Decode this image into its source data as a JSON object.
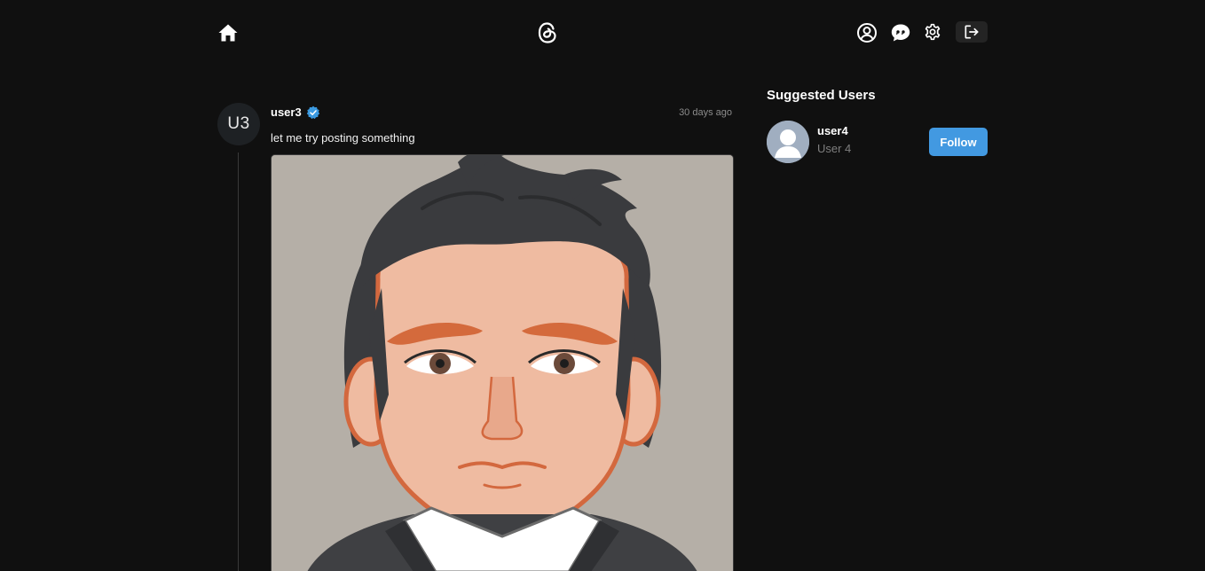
{
  "header": {
    "icons": [
      "home-icon",
      "threads-logo",
      "user-profile-icon",
      "chat-icon",
      "settings-gear-icon",
      "logout-icon"
    ]
  },
  "post": {
    "avatar_initials": "U3",
    "username": "user3",
    "verified_icon": "verified-badge-icon",
    "time": "30 days ago",
    "text": "let me try posting something"
  },
  "suggested": {
    "title": "Suggested Users",
    "users": [
      {
        "username": "user4",
        "name": "User 4",
        "button_label": "Follow"
      }
    ]
  },
  "colors": {
    "background": "#101010",
    "accent": "#4299e1",
    "verified": "#3b9ae1",
    "muted_text": "#7e7e7e"
  }
}
